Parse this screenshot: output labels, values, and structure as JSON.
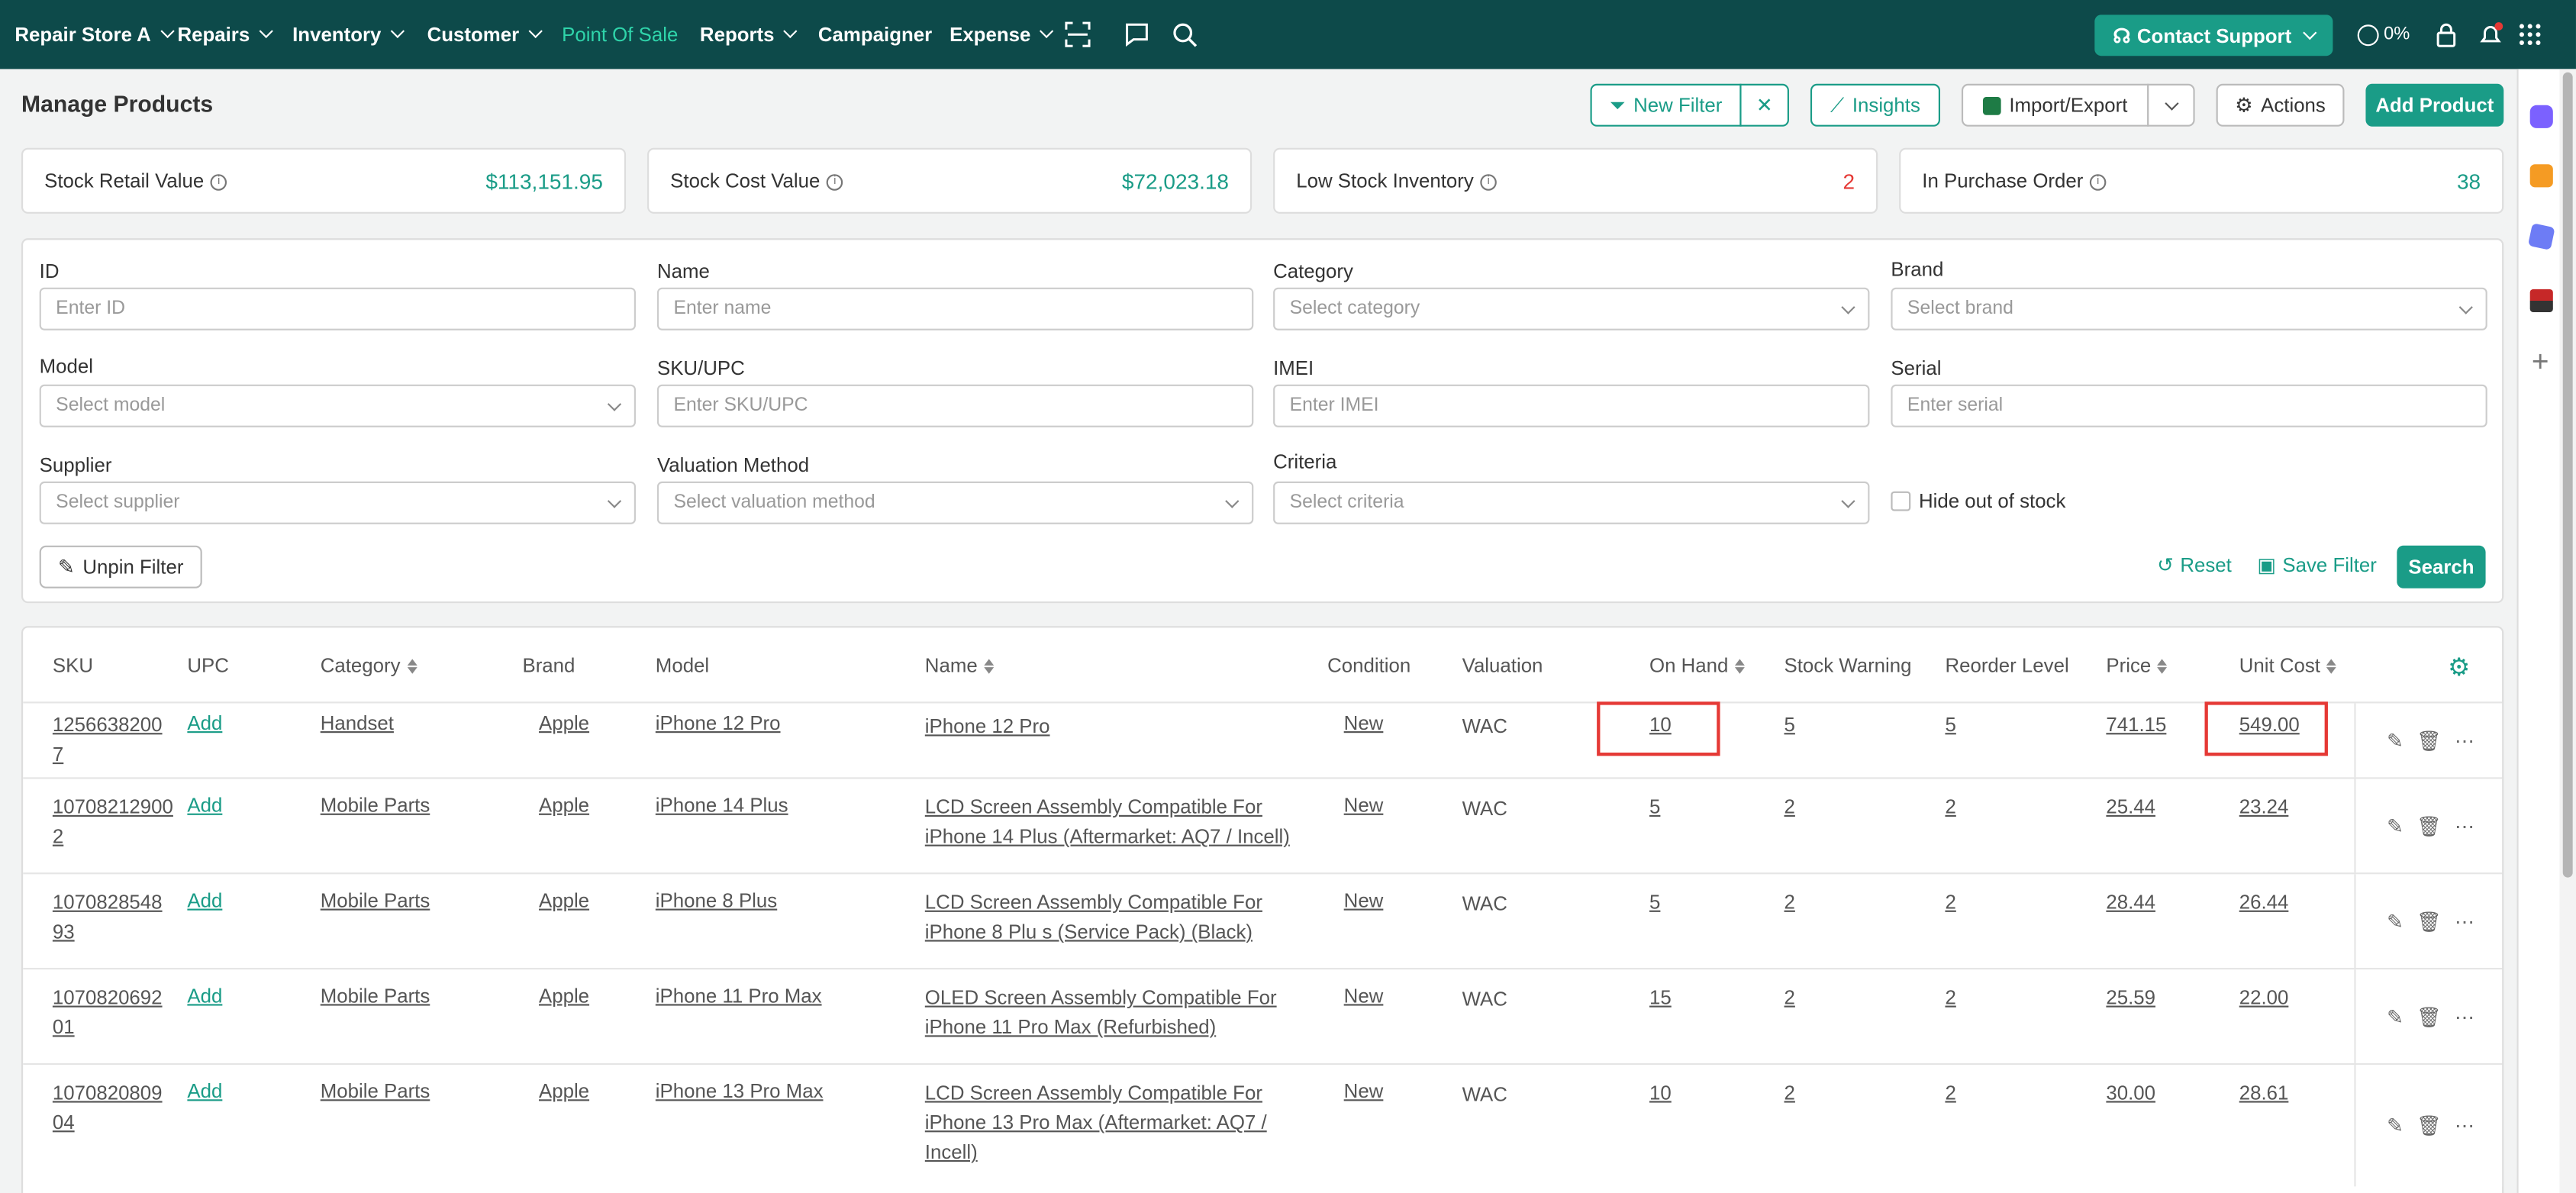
{
  "nav": {
    "store": "Repair Store A",
    "items": [
      "Repairs",
      "Inventory",
      "Customer",
      "Point Of Sale",
      "Reports",
      "Campaigner",
      "Expense"
    ],
    "contact_support": "Contact Support",
    "progress": "0%"
  },
  "page": {
    "title": "Manage Products",
    "new_filter": "New Filter",
    "insights": "Insights",
    "import_export": "Import/Export",
    "actions": "Actions",
    "add_product": "Add Product"
  },
  "stats": [
    {
      "label": "Stock Retail Value",
      "value": "$113,151.95"
    },
    {
      "label": "Stock Cost Value",
      "value": "$72,023.18"
    },
    {
      "label": "Low Stock Inventory",
      "value": "2"
    },
    {
      "label": "In Purchase Order",
      "value": "38"
    }
  ],
  "filters": {
    "id": {
      "label": "ID",
      "placeholder": "Enter ID"
    },
    "name": {
      "label": "Name",
      "placeholder": "Enter name"
    },
    "category": {
      "label": "Category",
      "placeholder": "Select category"
    },
    "brand": {
      "label": "Brand",
      "placeholder": "Select brand"
    },
    "model": {
      "label": "Model",
      "placeholder": "Select model"
    },
    "sku": {
      "label": "SKU/UPC",
      "placeholder": "Enter SKU/UPC"
    },
    "imei": {
      "label": "IMEI",
      "placeholder": "Enter IMEI"
    },
    "serial": {
      "label": "Serial",
      "placeholder": "Enter serial"
    },
    "supplier": {
      "label": "Supplier",
      "placeholder": "Select supplier"
    },
    "valuation": {
      "label": "Valuation Method",
      "placeholder": "Select valuation method"
    },
    "criteria": {
      "label": "Criteria",
      "placeholder": "Select criteria"
    },
    "hide_oos": "Hide out of stock",
    "unpin": "Unpin Filter",
    "reset": "Reset",
    "save": "Save Filter",
    "search": "Search"
  },
  "table": {
    "columns": [
      "SKU",
      "UPC",
      "Category",
      "Brand",
      "Model",
      "Name",
      "Condition",
      "Valuation",
      "On Hand",
      "Stock Warning",
      "Reorder Level",
      "Price",
      "Unit Cost"
    ],
    "rows": [
      {
        "sku1": "1256638200",
        "sku2": "7",
        "upc": "Add",
        "category": "Handset",
        "brand": "Apple",
        "model": "iPhone 12 Pro",
        "name1": "iPhone 12 Pro",
        "name2": "",
        "name3": "",
        "condition": "New",
        "valuation": "WAC",
        "on_hand": "10",
        "warning": "5",
        "reorder": "5",
        "price": "741.15",
        "cost": "549.00"
      },
      {
        "sku1": "10708212900",
        "sku2": "2",
        "upc": "Add",
        "category": "Mobile Parts",
        "brand": "Apple",
        "model": "iPhone 14 Plus",
        "name1": "LCD Screen Assembly Compatible For",
        "name2": "iPhone 14 Plus (Aftermarket: AQ7 / Incell)",
        "name3": "",
        "condition": "New",
        "valuation": "WAC",
        "on_hand": "5",
        "warning": "2",
        "reorder": "2",
        "price": "25.44",
        "cost": "23.24"
      },
      {
        "sku1": "1070828548",
        "sku2": "93",
        "upc": "Add",
        "category": "Mobile Parts",
        "brand": "Apple",
        "model": "iPhone 8 Plus",
        "name1": "LCD Screen Assembly Compatible For",
        "name2": "iPhone 8 Plu s (Service Pack) (Black)",
        "name3": "",
        "condition": "New",
        "valuation": "WAC",
        "on_hand": "5",
        "warning": "2",
        "reorder": "2",
        "price": "28.44",
        "cost": "26.44"
      },
      {
        "sku1": "1070820692",
        "sku2": "01",
        "upc": "Add",
        "category": "Mobile Parts",
        "brand": "Apple",
        "model": "iPhone 11 Pro Max",
        "name1": "OLED Screen Assembly Compatible For",
        "name2": "iPhone 11 Pro Max (Refurbished)",
        "name3": "",
        "condition": "New",
        "valuation": "WAC",
        "on_hand": "15",
        "warning": "2",
        "reorder": "2",
        "price": "25.59",
        "cost": "22.00"
      },
      {
        "sku1": "1070820809",
        "sku2": "04",
        "upc": "Add",
        "category": "Mobile Parts",
        "brand": "Apple",
        "model": "iPhone 13 Pro Max",
        "name1": "LCD Screen Assembly Compatible For",
        "name2": "iPhone 13 Pro Max (Aftermarket: AQ7 /",
        "name3": "Incell)",
        "condition": "New",
        "valuation": "WAC",
        "on_hand": "10",
        "warning": "2",
        "reorder": "2",
        "price": "30.00",
        "cost": "28.61"
      }
    ]
  },
  "colors": {
    "nav_bg": "#0d4a4a",
    "accent": "#1a9c87",
    "active_nav": "#2fd4aa",
    "highlight": "#e53935"
  }
}
